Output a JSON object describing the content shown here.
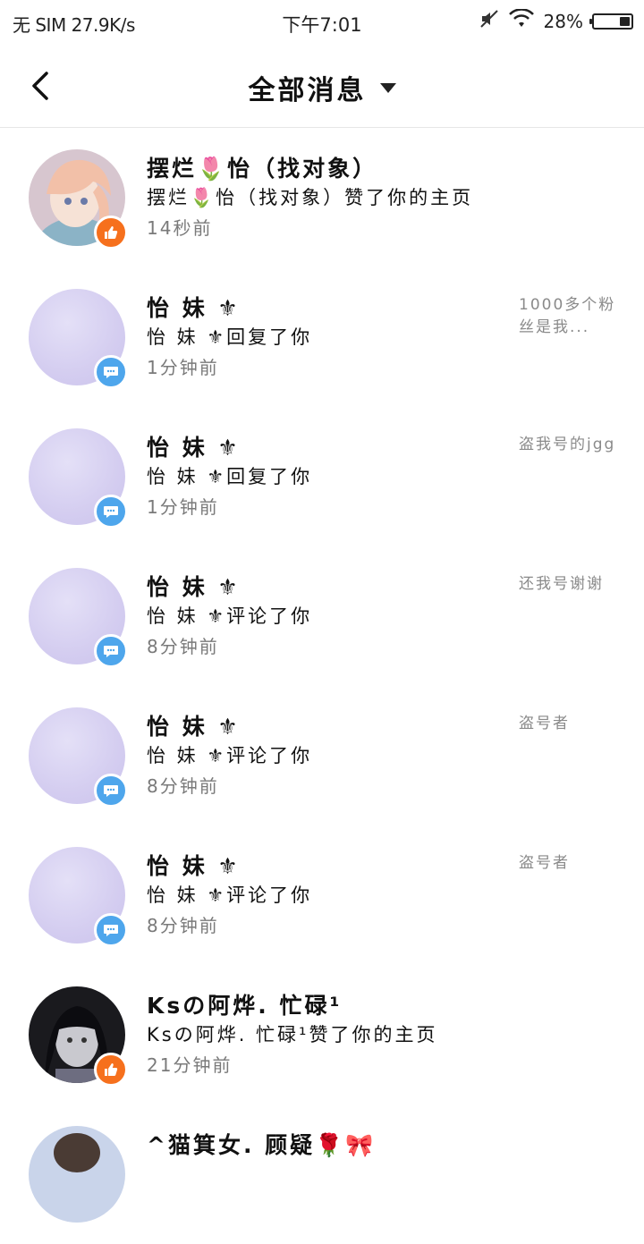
{
  "status_bar": {
    "carrier": "无 SIM 27.9K/s",
    "time": "下午7:01",
    "battery": "28%",
    "battery_level": 0.28
  },
  "header": {
    "title": "全部消息"
  },
  "messages": [
    {
      "name": "摆烂🌷怡（找对象）",
      "desc": "摆烂🌷怡（找对象）赞了你的主页",
      "time": "14秒前",
      "preview": "",
      "type": "like"
    },
    {
      "name": "怡  妹 ⚜",
      "desc": "怡  妹 ⚜回复了你",
      "time": "1分钟前",
      "preview": "1000多个粉丝是我...",
      "type": "comment"
    },
    {
      "name": "怡  妹 ⚜",
      "desc": "怡  妹 ⚜回复了你",
      "time": "1分钟前",
      "preview": "盗我号的jgg",
      "type": "comment"
    },
    {
      "name": "怡  妹 ⚜",
      "desc": "怡  妹 ⚜评论了你",
      "time": "8分钟前",
      "preview": "还我号谢谢",
      "type": "comment"
    },
    {
      "name": "怡  妹 ⚜",
      "desc": "怡  妹 ⚜评论了你",
      "time": "8分钟前",
      "preview": "盗号者",
      "type": "comment"
    },
    {
      "name": "怡  妹 ⚜",
      "desc": "怡  妹 ⚜评论了你",
      "time": "8分钟前",
      "preview": "盗号者",
      "type": "comment"
    },
    {
      "name": "Ksの阿烨. 忙碌¹",
      "desc": "Ksの阿烨. 忙碌¹赞了你的主页",
      "time": "21分钟前",
      "preview": "",
      "type": "like"
    },
    {
      "name": "^猫箕女. 顾疑🌹🎀",
      "desc": "",
      "time": "",
      "preview": "",
      "type": "like"
    }
  ]
}
